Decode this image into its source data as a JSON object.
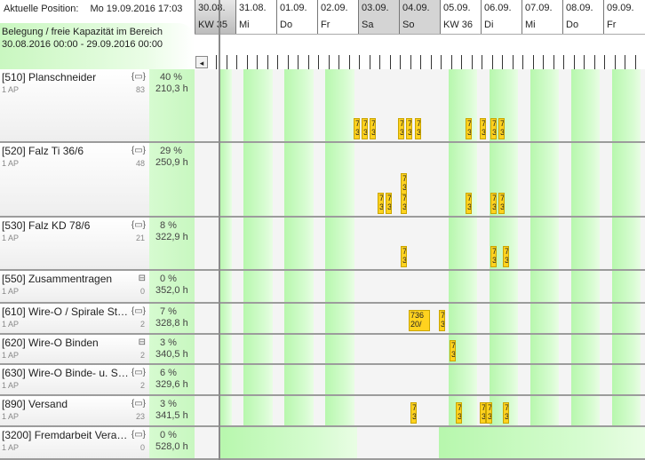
{
  "header": {
    "position_label": "Aktuelle Position:",
    "position_value": "Mo 19.09.2016 17:03",
    "range_title": "Belegung / freie Kapazität im Bereich",
    "range_value": "30.08.2016 00:00 - 29.09.2016 00:00"
  },
  "timeline": {
    "days": [
      {
        "date": "30.08.",
        "sub": "KW 35",
        "style": "kw"
      },
      {
        "date": "31.08.",
        "sub": "Mi",
        "style": "normal"
      },
      {
        "date": "01.09.",
        "sub": "Do",
        "style": "normal"
      },
      {
        "date": "02.09.",
        "sub": "Fr",
        "style": "normal"
      },
      {
        "date": "03.09.",
        "sub": "Sa",
        "style": "weekend"
      },
      {
        "date": "04.09.",
        "sub": "So",
        "style": "weekend"
      },
      {
        "date": "05.09.",
        "sub": "KW 36",
        "style": "normal"
      },
      {
        "date": "06.09.",
        "sub": "Di",
        "style": "normal"
      },
      {
        "date": "07.09.",
        "sub": "Mi",
        "style": "normal"
      },
      {
        "date": "08.09.",
        "sub": "Do",
        "style": "normal"
      },
      {
        "date": "09.09.",
        "sub": "Fr",
        "style": "normal"
      }
    ],
    "scroll_left_glyph": "◂"
  },
  "colors": {
    "available": "#bdf7b3",
    "job": "#ffd21f",
    "now_line": "#8a8a8a"
  },
  "resources": [
    {
      "name": "[510] Planschneider",
      "ap": "1 AP",
      "count": "83",
      "icon": "{▭}",
      "pct": "40 %",
      "hours": "210,3 h",
      "jobs": [
        {
          "label": "7\n3",
          "col": 7.1
        },
        {
          "label": "7\n3",
          "col": 7.3
        },
        {
          "label": "7\n3",
          "col": 7.5
        },
        {
          "label": "7\n3",
          "col": 8.2
        },
        {
          "label": "7\n3",
          "col": 8.4
        },
        {
          "label": "7\n3",
          "col": 8.6
        },
        {
          "label": "7\n3",
          "col": 9.85
        },
        {
          "label": "7\n3",
          "col": 10.2
        },
        {
          "label": "7\n3",
          "col": 10.45
        },
        {
          "label": "7\n3",
          "col": 10.65
        }
      ]
    },
    {
      "name": "[520] Falz Ti 36/6",
      "ap": "1 AP",
      "count": "48",
      "icon": "{▭}",
      "pct": "29 %",
      "hours": "250,9 h",
      "jobs": [
        {
          "label": "7\n3",
          "col": 7.7
        },
        {
          "label": "7\n3",
          "col": 7.9
        },
        {
          "label": "7\n3",
          "col": 8.25
        },
        {
          "label": "7\n3",
          "col": 8.25,
          "upper": true
        },
        {
          "label": "7\n3",
          "col": 9.85
        },
        {
          "label": "7\n3",
          "col": 10.45
        },
        {
          "label": "7\n3",
          "col": 10.65
        }
      ]
    },
    {
      "name": "[530] Falz KD 78/6",
      "ap": "1 AP",
      "count": "21",
      "icon": "{▭}",
      "pct": "8 %",
      "hours": "322,9 h",
      "jobs": [
        {
          "label": "7\n3",
          "col": 8.25
        },
        {
          "label": "7\n3",
          "col": 10.45
        },
        {
          "label": "7\n3",
          "col": 10.75
        }
      ]
    },
    {
      "name": "[550] Zusammentragen",
      "ap": "1 AP",
      "count": "0",
      "icon": "⊟",
      "pct": "0 %",
      "hours": "352,0 h",
      "jobs": []
    },
    {
      "name": "[610] Wire-O / Spirale Sta...",
      "ap": "1 AP",
      "count": "2",
      "icon": "{▭}",
      "pct": "7 %",
      "hours": "328,8 h",
      "jobs": [
        {
          "label": "736\n20/",
          "col": 8.45,
          "wide": true
        },
        {
          "label": "7\n3",
          "col": 9.2
        }
      ]
    },
    {
      "name": "[620] Wire-O Binden",
      "ap": "1 AP",
      "count": "2",
      "icon": "⊟",
      "pct": "3 %",
      "hours": "340,5 h",
      "jobs": [
        {
          "label": "7\n3",
          "col": 9.45
        }
      ]
    },
    {
      "name": "[630] Wire-O Binde- u. Sta...",
      "ap": "1 AP",
      "count": "2",
      "icon": "{▭}",
      "pct": "6 %",
      "hours": "329,6 h",
      "jobs": []
    },
    {
      "name": "[890] Versand",
      "ap": "1 AP",
      "count": "23",
      "icon": "{▭}",
      "pct": "3 %",
      "hours": "341,5 h",
      "jobs": [
        {
          "label": "7\n3",
          "col": 8.5
        },
        {
          "label": "7\n3",
          "col": 9.6
        },
        {
          "label": "7\n3",
          "col": 10.2
        },
        {
          "label": "7\n3",
          "col": 10.35
        },
        {
          "label": "7\n3",
          "col": 10.75
        }
      ]
    },
    {
      "name": "[3200] Fremdarbeit Verarb...",
      "ap": "1 AP",
      "count": "0",
      "icon": "{▭}",
      "pct": "0 %",
      "hours": "528,0 h",
      "jobs": [],
      "full": true
    }
  ]
}
